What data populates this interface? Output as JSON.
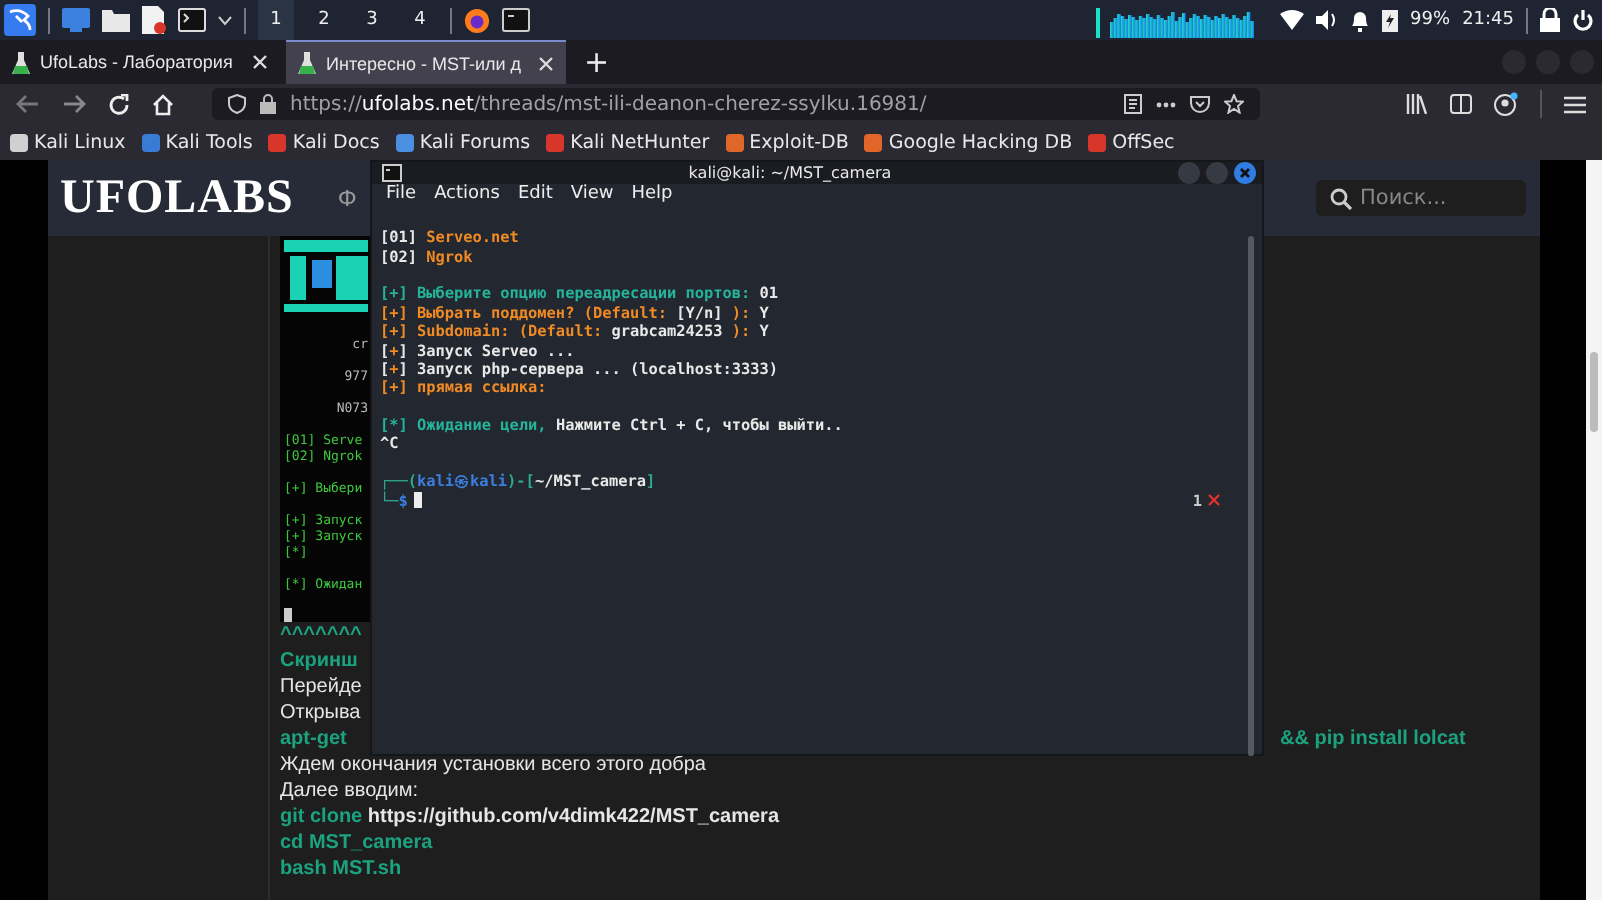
{
  "top_panel": {
    "workspaces": [
      {
        "label": "1",
        "selected": true
      },
      {
        "label": "2",
        "selected": false
      },
      {
        "label": "3",
        "selected": false
      },
      {
        "label": "4",
        "selected": false
      }
    ],
    "battery": "99%",
    "clock": "21:45"
  },
  "browser": {
    "tabs": [
      {
        "title": "UfoLabs - Лаборатория",
        "selected": false
      },
      {
        "title": "Интересно - MST-или д",
        "selected": true
      }
    ],
    "new_tab": "+",
    "url": {
      "scheme": "https://",
      "domain": "ufolabs.net",
      "path": "/threads/mst-ili-deanon-cherez-ssylku.16981/"
    },
    "bookmarks": [
      {
        "label": "Kali Linux",
        "color": "#d0d0d0"
      },
      {
        "label": "Kali Tools",
        "color": "#3a7bd5"
      },
      {
        "label": "Kali Docs",
        "color": "#d9362b"
      },
      {
        "label": "Kali Forums",
        "color": "#4a8fe0"
      },
      {
        "label": "Kali NetHunter",
        "color": "#d9362b"
      },
      {
        "label": "Exploit-DB",
        "color": "#e0662a"
      },
      {
        "label": "Google Hacking DB",
        "color": "#e0662a"
      },
      {
        "label": "OffSec",
        "color": "#d9362b"
      }
    ]
  },
  "page": {
    "logo": "UFOLABS",
    "nav_fragment": "Ф",
    "search": {
      "placeholder": "Поиск..."
    },
    "screenshot_blocks": [
      {
        "kind": "banner",
        "lines": [
          "cr",
          "977",
          "N073"
        ]
      },
      {
        "kind": "log",
        "lines": [
          "[01] Serve",
          "[02] Ngrok"
        ]
      },
      {
        "kind": "log",
        "lines": [
          "[+] Выбери"
        ]
      },
      {
        "kind": "log",
        "lines": [
          "[+] Запуск",
          "[+] Запуск",
          "[*]"
        ]
      },
      {
        "kind": "log",
        "lines": [
          "[*] Ожидан"
        ]
      }
    ],
    "article": [
      {
        "segments": [
          {
            "text": "^^^^^^^",
            "kind": "command"
          }
        ]
      },
      {
        "segments": [
          {
            "text": "Скринш",
            "kind": "command"
          }
        ]
      },
      {
        "segments": [
          {
            "text": "Перейде",
            "kind": "text"
          }
        ]
      },
      {
        "segments": [
          {
            "text": "Открыва",
            "kind": "text"
          }
        ]
      },
      {
        "segments": [
          {
            "text": "apt-get",
            "kind": "command"
          }
        ],
        "tail": [
          {
            "text": "&& pip install lolcat",
            "kind": "command"
          }
        ]
      },
      {
        "segments": [
          {
            "text": "Ждем окончания установки всего этого добра",
            "kind": "text"
          }
        ]
      },
      {
        "segments": [
          {
            "text": "Далее вводим:",
            "kind": "text"
          }
        ]
      },
      {
        "segments": [
          {
            "text": "git clone",
            "kind": "command"
          },
          {
            "text": " https://github.com/v4dimk422/MST_camera",
            "kind": "link"
          }
        ]
      },
      {
        "segments": [
          {
            "text": "cd MST_camera",
            "kind": "command"
          }
        ]
      },
      {
        "segments": [
          {
            "text": "bash MST.sh",
            "kind": "command"
          }
        ]
      }
    ]
  },
  "terminal": {
    "title": "kali@kali: ~/MST_camera",
    "menu": [
      "File",
      "Actions",
      "Edit",
      "View",
      "Help"
    ],
    "pane_count": "1",
    "blocks": [
      [
        [
          {
            "text": "[01]",
            "color": "#e8e8e8"
          },
          {
            "text": " Serveo.net",
            "color": "#f08a24"
          }
        ],
        [
          {
            "text": "[02]",
            "color": "#e8e8e8"
          },
          {
            "text": " Ngrok",
            "color": "#f08a24"
          }
        ]
      ],
      [
        [
          {
            "text": "[+] Выберите опцию переадресации портов:",
            "color": "#25b39a"
          },
          {
            "text": " 01",
            "color": "#e8e8e8"
          }
        ],
        [
          {
            "text": "[+] Выбрать поддомен? (Default: ",
            "color": "#f08a24"
          },
          {
            "text": "[Y/n]",
            "color": "#e8e8e8"
          },
          {
            "text": " ):",
            "color": "#f08a24"
          },
          {
            "text": " Y",
            "color": "#e8e8e8"
          }
        ],
        [
          {
            "text": "[+] Subdomain: (Default: ",
            "color": "#f08a24"
          },
          {
            "text": "grabcam24253",
            "color": "#e8e8e8"
          },
          {
            "text": " ):",
            "color": "#f08a24"
          },
          {
            "text": " Y",
            "color": "#e8e8e8"
          }
        ],
        [
          {
            "text": "[",
            "color": "#e8e8e8"
          },
          {
            "text": "+",
            "color": "#f08a24"
          },
          {
            "text": "] Запуск Serveo ...",
            "color": "#e8e8e8"
          }
        ],
        [
          {
            "text": "[",
            "color": "#e8e8e8"
          },
          {
            "text": "+",
            "color": "#f08a24"
          },
          {
            "text": "] Запуск php-сервера ... (localhost:3333)",
            "color": "#e8e8e8"
          }
        ],
        [
          {
            "text": "[+] прямая ссылка:",
            "color": "#f08a24"
          }
        ]
      ],
      [
        [
          {
            "text": "[*] Ожидание цели,",
            "color": "#25b39a"
          },
          {
            "text": " Нажмите Ctrl + C, чтобы выйти..",
            "color": "#e8e8e8"
          }
        ],
        [
          {
            "text": "^C",
            "color": "#e8e8e8"
          }
        ]
      ],
      [
        [
          {
            "text": "┌──(",
            "color": "#2fa88f"
          },
          {
            "text": "kali㉿kali",
            "color": "#3c7fe0"
          },
          {
            "text": ")-[",
            "color": "#2fa88f"
          },
          {
            "text": "~/MST_camera",
            "color": "#e8e8e8"
          },
          {
            "text": "]",
            "color": "#2fa88f"
          }
        ],
        [
          {
            "text": "└─",
            "color": "#2fa88f"
          },
          {
            "text": "$",
            "color": "#3c7fe0"
          }
        ]
      ]
    ]
  }
}
